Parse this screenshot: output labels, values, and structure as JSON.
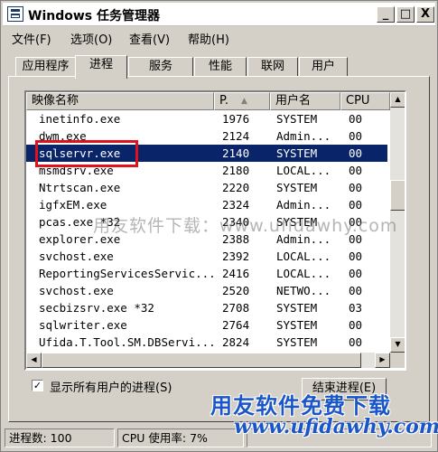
{
  "window": {
    "title": "Windows 任务管理器",
    "controls": {
      "minimize": "_",
      "maximize": "□",
      "close": "X"
    }
  },
  "menu": [
    "文件(F)",
    "选项(O)",
    "查看(V)",
    "帮助(H)"
  ],
  "tabs": [
    "应用程序",
    "进程",
    "服务",
    "性能",
    "联网",
    "用户"
  ],
  "active_tab": "进程",
  "table": {
    "columns": [
      "映像名称",
      "P.",
      "用户名",
      "CPU"
    ],
    "sort_indicator": "▲",
    "rows": [
      {
        "name": "inetinfo.exe",
        "pid": "1976",
        "user": "SYSTEM",
        "cpu": "00"
      },
      {
        "name": "dwm.exe",
        "pid": "2124",
        "user": "Admin...",
        "cpu": "00"
      },
      {
        "name": "sqlservr.exe",
        "pid": "2140",
        "user": "SYSTEM",
        "cpu": "00",
        "selected": true
      },
      {
        "name": "msmdsrv.exe",
        "pid": "2180",
        "user": "LOCAL...",
        "cpu": "00"
      },
      {
        "name": "Ntrtscan.exe",
        "pid": "2220",
        "user": "SYSTEM",
        "cpu": "00"
      },
      {
        "name": "igfxEM.exe",
        "pid": "2324",
        "user": "Admin...",
        "cpu": "00"
      },
      {
        "name": "pcas.exe *32",
        "pid": "2340",
        "user": "SYSTEM",
        "cpu": "00"
      },
      {
        "name": "explorer.exe",
        "pid": "2388",
        "user": "Admin...",
        "cpu": "00"
      },
      {
        "name": "svchost.exe",
        "pid": "2392",
        "user": "LOCAL...",
        "cpu": "00"
      },
      {
        "name": "ReportingServicesServic...",
        "pid": "2416",
        "user": "LOCAL...",
        "cpu": "00"
      },
      {
        "name": "svchost.exe",
        "pid": "2520",
        "user": "NETWO...",
        "cpu": "00"
      },
      {
        "name": "secbizsrv.exe *32",
        "pid": "2708",
        "user": "SYSTEM",
        "cpu": "03"
      },
      {
        "name": "sqlwriter.exe",
        "pid": "2764",
        "user": "SYSTEM",
        "cpu": "00"
      },
      {
        "name": "Ufida.T.Tool.SM.DBServi...",
        "pid": "2824",
        "user": "SYSTEM",
        "cpu": "00"
      }
    ]
  },
  "scrollbar": {
    "up": "▲",
    "down": "▼",
    "left": "◀",
    "right": "▶"
  },
  "show_all_users": {
    "label": "显示所有用户的进程(S)",
    "checked": true,
    "mark": "✓"
  },
  "end_process_button": "结束进程(E)",
  "status": {
    "process_count": "进程数: 100",
    "cpu_usage": "CPU 使用率: 7%"
  },
  "watermarks": {
    "center": "用友软件下载：www.ufidawhy.com",
    "corner_line1": "用友软件免费下载",
    "corner_line2": "www.ufidawhy.com"
  },
  "colors": {
    "selection": "#0a246a",
    "highlight_box": "#e0111a",
    "watermark": "#1b56c9"
  }
}
